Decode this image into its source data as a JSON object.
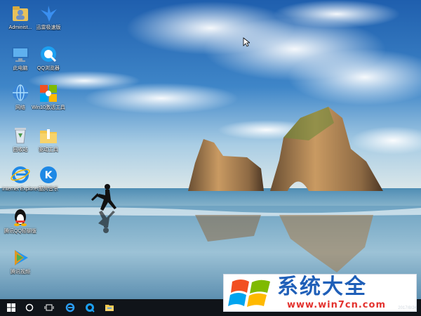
{
  "desktop": {
    "icons": [
      {
        "label": "Administ...",
        "icon": "user-folder-icon"
      },
      {
        "label": "迅雷极速版",
        "icon": "thunder-bird-icon"
      },
      {
        "label": "此电脑",
        "icon": "computer-icon"
      },
      {
        "label": "QQ浏览器",
        "icon": "qq-browser-icon"
      },
      {
        "label": "网络",
        "icon": "network-icon"
      },
      {
        "label": "Win10激活工具",
        "icon": "win10-activator-icon"
      },
      {
        "label": "回收站",
        "icon": "recycle-bin-icon"
      },
      {
        "label": "驱动工具",
        "icon": "folder-icon"
      },
      {
        "label": "Internet Explorer",
        "icon": "internet-explorer-icon"
      },
      {
        "label": "酷狗音乐",
        "icon": "kugou-music-icon"
      },
      {
        "label": "腾讯QQ轻聊版",
        "icon": "qq-penguin-icon"
      },
      {
        "label": "腾讯视频",
        "icon": "tencent-video-icon"
      }
    ]
  },
  "taskbar": {
    "buttons": [
      "windows-start-icon",
      "cortana-search-icon",
      "task-view-icon",
      "edge-icon",
      "qq-browser-icon",
      "file-explorer-icon"
    ]
  },
  "watermark": {
    "title": "系统大全",
    "url": "www.win7cn.com",
    "date": "2017/8/24"
  },
  "colors": {
    "taskbar": "#101419",
    "watermark_blue": "#1f5fb8",
    "watermark_red": "#e3322e"
  }
}
